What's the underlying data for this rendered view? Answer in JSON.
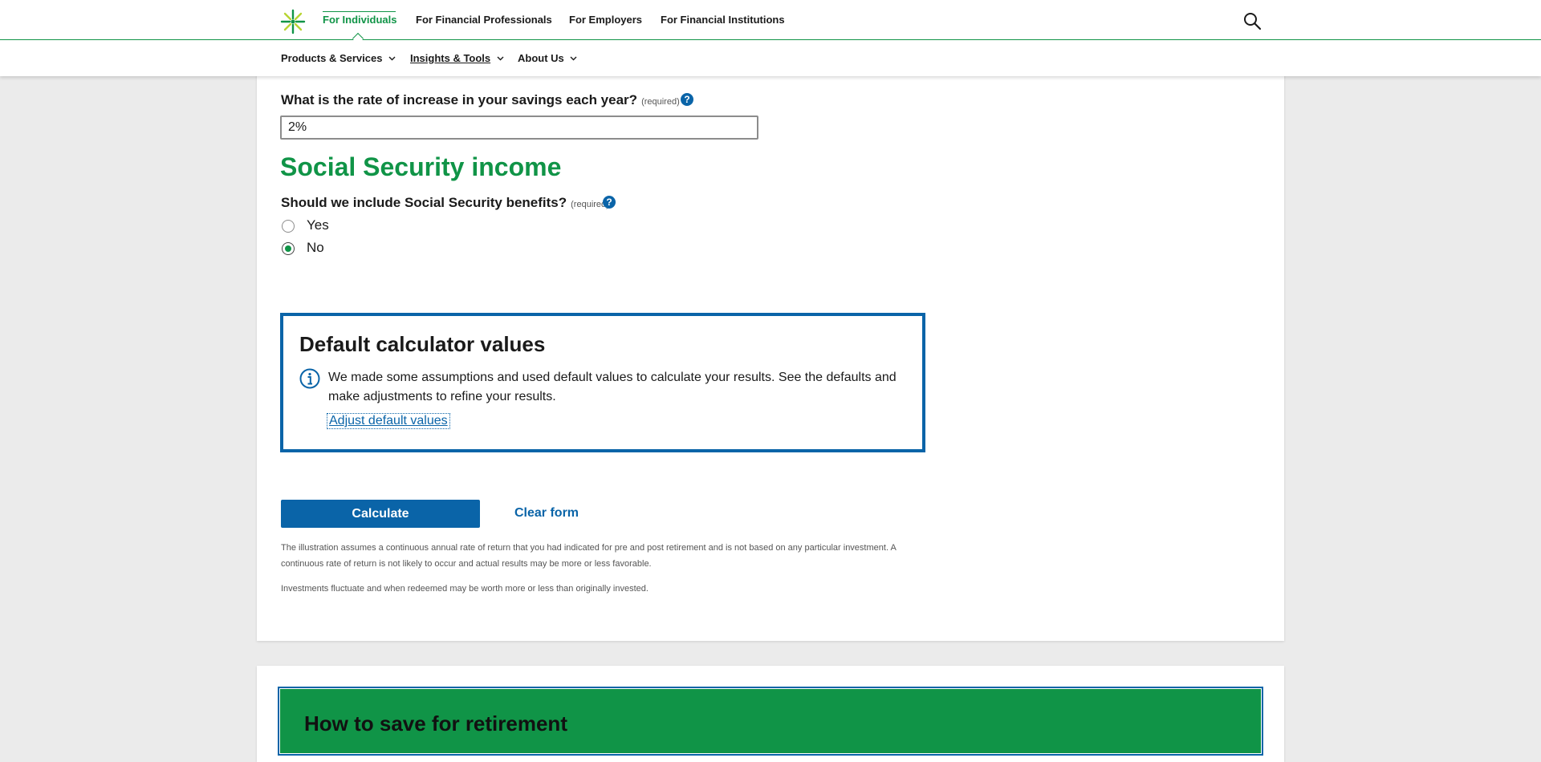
{
  "header": {
    "nav": [
      {
        "label": "For Individuals",
        "active": true
      },
      {
        "label": "For Financial Professionals"
      },
      {
        "label": "For Employers"
      },
      {
        "label": "For Financial Institutions"
      }
    ],
    "search_icon": "search-icon",
    "logo_icon": "starburst-logo"
  },
  "subnav": [
    {
      "label": "Products & Services"
    },
    {
      "label": "Insights & Tools",
      "underlined": true
    },
    {
      "label": "About Us"
    }
  ],
  "savings_increase": {
    "label": "What is the rate of increase in your savings each year?",
    "required": "(required)",
    "help": "?",
    "value": "2%"
  },
  "social_security": {
    "title": "Social Security income",
    "question": "Should we include Social Security benefits?",
    "required": "(required)",
    "help": "?",
    "options": [
      {
        "label": "Yes",
        "checked": false
      },
      {
        "label": "No",
        "checked": true
      }
    ]
  },
  "defaults_box": {
    "title": "Default calculator values",
    "text": "We made some assumptions and used default values to calculate your results. See the defaults and make adjustments to refine your results.",
    "link": "Adjust default values"
  },
  "actions": {
    "calculate": "Calculate",
    "clear": "Clear form"
  },
  "disclaimers": [
    "The illustration assumes a continuous annual rate of return that you had indicated for pre and post retirement and is not based on any particular investment. A continuous rate of return is not likely to occur and actual results may be more or less favorable.",
    "Investments fluctuate and when redeemed may be worth more or less than originally invested."
  ],
  "bottom_panel": {
    "title": "How to save for retirement"
  },
  "colors": {
    "brand_green": "#109447",
    "link_blue": "#0a64a8",
    "page_bg": "#ebebeb"
  }
}
